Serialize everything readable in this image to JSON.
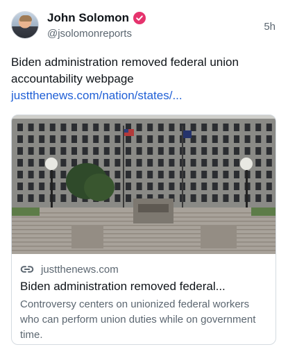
{
  "author": {
    "display_name": "John Solomon",
    "handle": "@jsolomonreports",
    "time_ago": "5h",
    "verified_color": "#e5336d"
  },
  "post": {
    "text": "Biden administration removed federal union accountability webpage ",
    "link_text": "justthenews.com/nation/states/..."
  },
  "card": {
    "domain": "justthenews.com",
    "title": "Biden administration removed federal...",
    "description": "Controversy centers on unionized federal workers who can perform union duties while on government time.",
    "link_icon": "link-icon"
  },
  "colors": {
    "link": "#1f5fd6",
    "secondary_text": "#5b6670"
  }
}
